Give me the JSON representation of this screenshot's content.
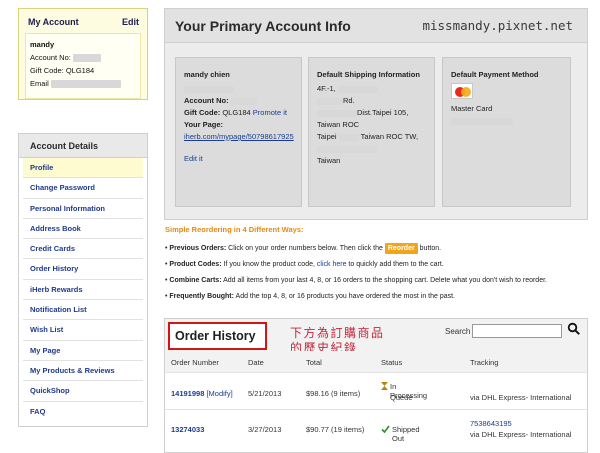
{
  "my_account": {
    "title": "My Account",
    "edit_label": "Edit",
    "name": "mandy",
    "account_no_label": "Account No:",
    "gift_code": "Gift Code: QLG184",
    "email_label": "Email"
  },
  "account_details": {
    "title": "Account Details",
    "items": [
      {
        "label": "Profile"
      },
      {
        "label": "Change Password"
      },
      {
        "label": "Personal Information"
      },
      {
        "label": "Address Book"
      },
      {
        "label": "Credit Cards"
      },
      {
        "label": "Order History"
      },
      {
        "label": "iHerb Rewards"
      },
      {
        "label": "Notification List"
      },
      {
        "label": "Wish List"
      },
      {
        "label": "My Page"
      },
      {
        "label": "My Products & Reviews"
      },
      {
        "label": "QuickShop"
      },
      {
        "label": "FAQ"
      }
    ]
  },
  "primary_info": {
    "title": "Your Primary Account Info",
    "watermark": "missmandy.pixnet.net",
    "profile": {
      "name": "mandy chien",
      "account_no_label": "Account No:",
      "gift_code_label": "Gift Code:",
      "gift_code_value": "QLG184",
      "promote_link": "Promote it",
      "your_page_label": "Your Page:",
      "page_url": "iherb.com/mypage/50798617925",
      "edit_link": "Edit it"
    },
    "shipping": {
      "title": "Default Shipping Information",
      "line1": "4F.-1,",
      "line2": "Rd.",
      "line3": "Dist.Taipei 105,",
      "line4": "Taiwan ROC",
      "line5a": "Taipei",
      "line5b": "Taiwan ROC TW,",
      "line6": "Taiwan"
    },
    "payment": {
      "title": "Default Payment Method",
      "card_icon": "mastercard-logo",
      "card_name": "Master Card"
    }
  },
  "reorder": {
    "title": "Simple Reordering in 4 Different Ways:",
    "previous_label": "Previous Orders:",
    "previous_text": "Click on your order numbers below. Then click the",
    "reorder_btn": "Reorder",
    "previous_tail": "button.",
    "codes_label": "Product Codes:",
    "codes_text": "If you know the product code,",
    "codes_link": "click here",
    "codes_tail": "to quickly add them to the cart.",
    "combine_label": "Combine Carts:",
    "combine_text": "Add all items from your last 4, 8, or 16 orders to the shopping cart. Delete what you don't wish to reorder.",
    "frequent_label": "Frequently Bought:",
    "frequent_text": "Add the top 4, 8, or 16 products you have ordered the most in the past."
  },
  "order_history": {
    "title": "Order History",
    "handwriting_1": "下方為訂購商品",
    "handwriting_2": "的歷史紀錄",
    "search_label": "Search",
    "search_icon": "magnifier-icon",
    "columns": [
      "Order Number",
      "Date",
      "Total",
      "Status",
      "Tracking"
    ],
    "rows": [
      {
        "number": "14191998",
        "modify": "[Modify]",
        "date": "5/21/2013",
        "total": "$98.16 (9 items)",
        "status_1": "In Processing",
        "status_2": "Queue",
        "tracking_link": "",
        "tracking_via": "via DHL Express- International"
      },
      {
        "number": "13274033",
        "modify": "",
        "date": "3/27/2013",
        "total": "$90.77 (19 items)",
        "status_1": "Shipped Out",
        "status_2": "",
        "tracking_link": "7538643195",
        "tracking_via": "via DHL Express- International"
      }
    ]
  },
  "colors": {
    "accent": "#e58a14",
    "link": "#1a3d8f",
    "annotation_red": "#d11515"
  }
}
